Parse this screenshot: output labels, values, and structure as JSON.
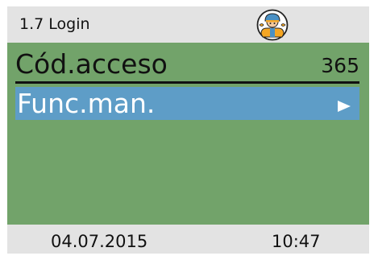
{
  "header": {
    "title": "1.7 Login",
    "icon": "installer-avatar-icon"
  },
  "menu": {
    "access_code": {
      "label": "Cód.acceso",
      "value": "365"
    },
    "manual_function": {
      "label": "Func.man.",
      "arrow_icon": "right-triangle-icon",
      "selected": true
    }
  },
  "footer": {
    "date": "04.07.2015",
    "time": "10:47"
  },
  "colors": {
    "header_bg": "#e3e3e3",
    "content_bg": "#72a36a",
    "selection_bg": "#5e9dc7",
    "text": "#111111",
    "selected_text": "#ffffff",
    "avatar_orange": "#f5a623",
    "avatar_blue": "#4a90c4"
  }
}
